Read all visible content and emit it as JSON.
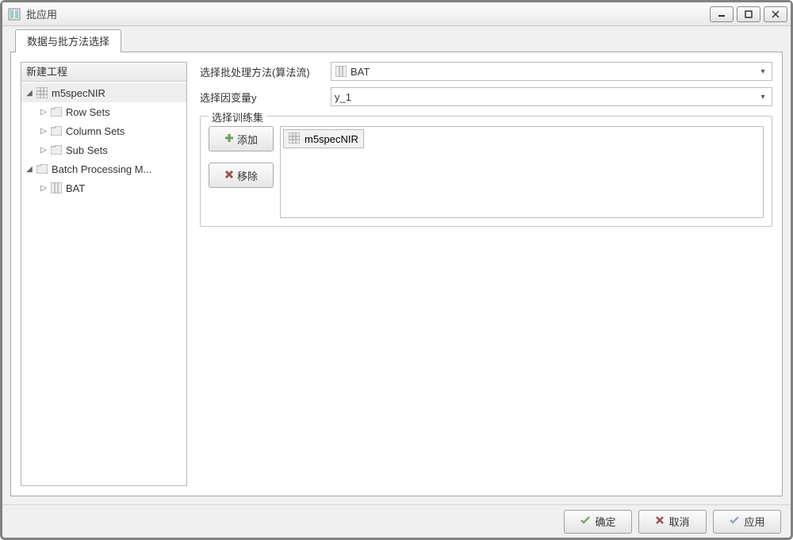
{
  "window": {
    "title": "批应用"
  },
  "tab": {
    "label": "数据与批方法选择"
  },
  "tree": {
    "header": "新建工程",
    "n0": {
      "label": "m5specNIR"
    },
    "n0c": [
      {
        "label": "Row Sets"
      },
      {
        "label": "Column Sets"
      },
      {
        "label": "Sub Sets"
      }
    ],
    "n1": {
      "label": "Batch Processing M..."
    },
    "n1c": [
      {
        "label": "BAT"
      }
    ]
  },
  "form": {
    "method_label": "选择批处理方法(算法流)",
    "method_value": "BAT",
    "yvar_label": "选择因变量y",
    "yvar_value": "y_1"
  },
  "trainset": {
    "legend": "选择训练集",
    "add_label": "添加",
    "remove_label": "移除",
    "items": [
      {
        "label": "m5specNIR"
      }
    ]
  },
  "buttons": {
    "ok": "确定",
    "cancel": "取消",
    "apply": "应用"
  }
}
